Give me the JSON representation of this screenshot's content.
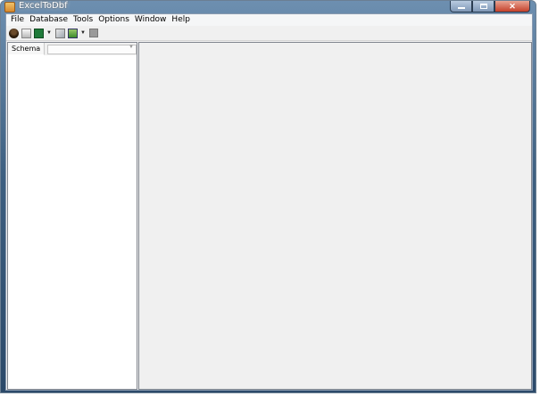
{
  "window": {
    "title": "ExcelToDbf"
  },
  "menubar": {
    "items": [
      "File",
      "Database",
      "Tools",
      "Options",
      "Window",
      "Help"
    ]
  },
  "toolbar": {
    "buttons": [
      {
        "icon": "user-icon"
      },
      {
        "icon": "new-document-icon"
      },
      {
        "icon": "excel-icon"
      },
      {
        "icon": "edit-icon"
      },
      {
        "icon": "image-icon"
      },
      {
        "icon": "stop-icon"
      }
    ]
  },
  "leftpane": {
    "schema_label": "Schema",
    "schema_value": ""
  }
}
